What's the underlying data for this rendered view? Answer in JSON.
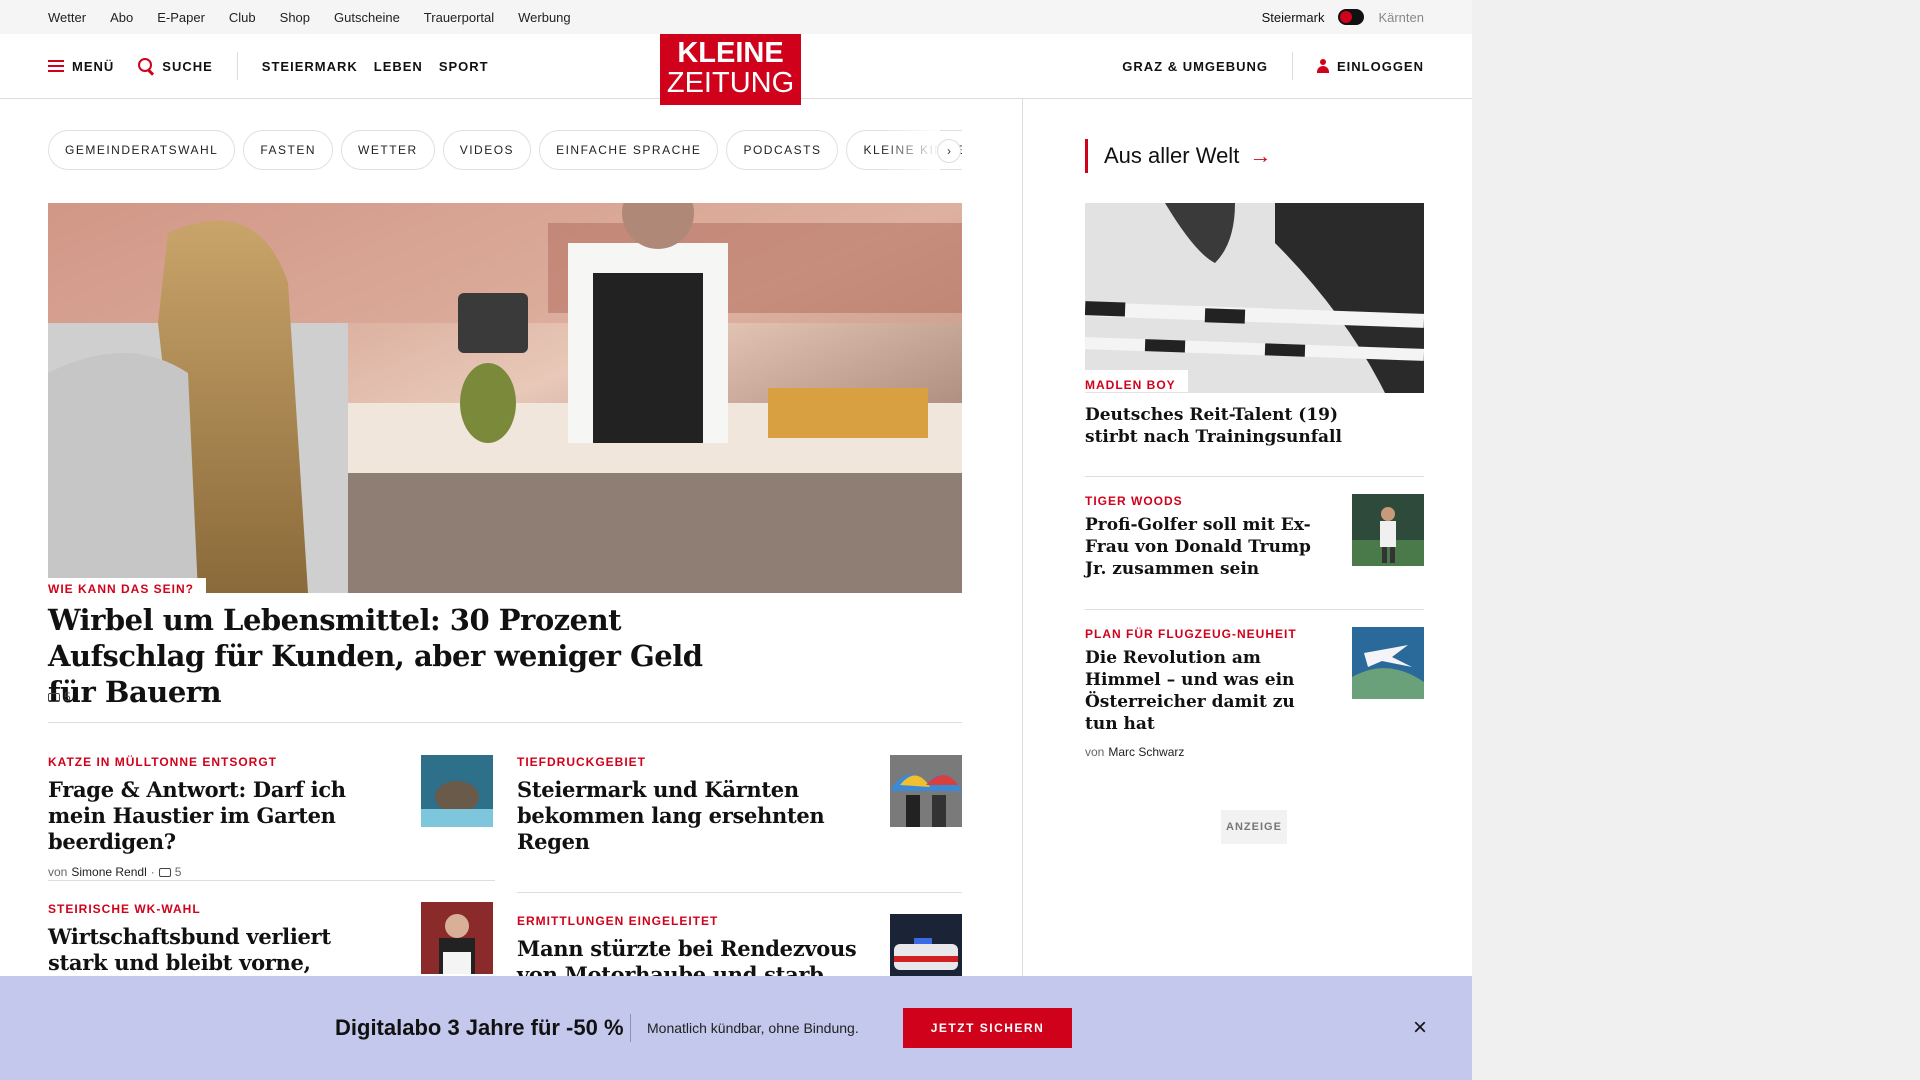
{
  "utility_bar": {
    "links": [
      "Wetter",
      "Abo",
      "E-Paper",
      "Club",
      "Shop",
      "Gutscheine",
      "Trauerportal",
      "Werbung"
    ],
    "region_active": "Steiermark",
    "region_inactive": "Kärnten"
  },
  "nav": {
    "menu_label": "MENÜ",
    "search_label": "SUCHE",
    "sections": [
      "STEIERMARK",
      "LEBEN",
      "SPORT"
    ],
    "logo_line1": "KLEINE",
    "logo_line2": "ZEITUNG",
    "region_link": "GRAZ & UMGEBUNG",
    "login_label": "EINLOGGEN"
  },
  "topic_chips": [
    "GEMEINDERATSWAHL",
    "FASTEN",
    "WETTER",
    "VIDEOS",
    "EINFACHE SPRACHE",
    "PODCASTS",
    "KLEINE KINDER"
  ],
  "chip_next": "›",
  "hero": {
    "kicker": "WIE KANN DAS SEIN?",
    "title": "Wirbel um Lebensmittel: 30 Prozent Aufschlag für Kunden, aber weniger Geld für Bauern",
    "comments": "5"
  },
  "articles": [
    {
      "kicker": "KATZE IN MÜLLTONNE ENTSORGT",
      "title": "Frage & Antwort: Darf ich mein Haustier im Garten beerdigen?",
      "by_prefix": "von",
      "author": "Simone Rendl",
      "comments": "5"
    },
    {
      "kicker": "TIEFDRUCKGEBIET",
      "title": "Steiermark und Kärnten bekommen lang ersehnten Regen"
    },
    {
      "kicker": "STEIRISCHE WK-WAHL",
      "title": "Wirtschaftsbund verliert stark und bleibt vorne,"
    },
    {
      "kicker": "ERMITTLUNGEN EINGELEITET",
      "title": "Mann stürzte bei Rendezvous von Motorhaube und starb"
    }
  ],
  "sidebar": {
    "section_title": "Aus aller Welt",
    "section_arrow": "→",
    "items": [
      {
        "kicker": "MADLEN BOY",
        "title": "Deutsches Reit-Talent (19) stirbt nach Trainingsunfall"
      },
      {
        "kicker": "TIGER WOODS",
        "title": "Profi-Golfer soll mit Ex-Frau von Donald Trump Jr. zusammen sein"
      },
      {
        "kicker": "PLAN FÜR FLUGZEUG-NEUHEIT",
        "title": "Die Revolution am Himmel – und was ein Österreicher damit zu tun hat",
        "by_prefix": "von",
        "author": "Marc Schwarz"
      }
    ],
    "ad_label": "ANZEIGE"
  },
  "promo": {
    "title": "Digitalabo 3 Jahre für -50 %",
    "subtitle": "Monatlich kündbar, ohne Bindung.",
    "button": "JETZT SICHERN",
    "close": "×"
  },
  "colors": {
    "brand_red": "#d0021b",
    "promo_bg": "#c3c8ec"
  }
}
